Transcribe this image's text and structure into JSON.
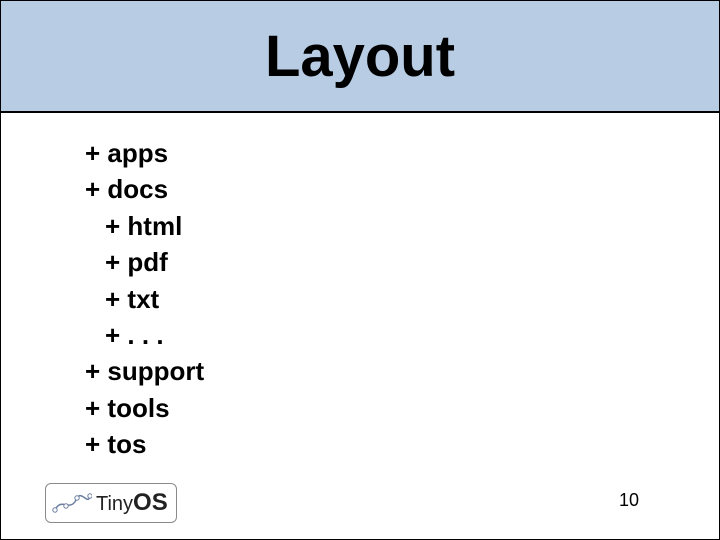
{
  "title": "Layout",
  "tree": {
    "items": [
      {
        "prefix": "+ ",
        "label": "apps",
        "indent": 0
      },
      {
        "prefix": "+ ",
        "label": "docs",
        "indent": 0
      },
      {
        "prefix": "+ ",
        "label": "html",
        "indent": 1
      },
      {
        "prefix": "+ ",
        "label": "pdf",
        "indent": 1
      },
      {
        "prefix": "+ ",
        "label": "txt",
        "indent": 1
      },
      {
        "prefix": "+ ",
        "label": ". . .",
        "indent": 1
      },
      {
        "prefix": "+ ",
        "label": "support",
        "indent": 0
      },
      {
        "prefix": "+ ",
        "label": "tools",
        "indent": 0
      },
      {
        "prefix": "+ ",
        "label": "tos",
        "indent": 0
      }
    ]
  },
  "logo": {
    "text_tiny": "Tiny",
    "text_os": "OS"
  },
  "page_number": "10"
}
